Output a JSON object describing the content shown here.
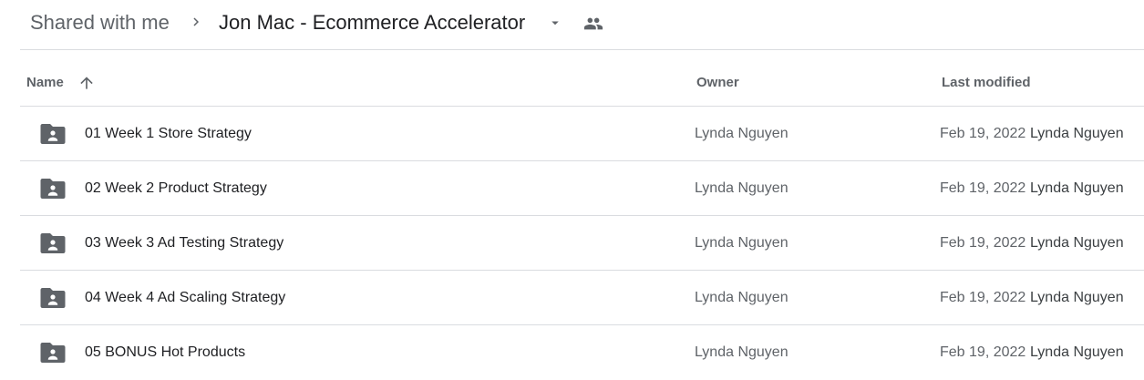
{
  "breadcrumb": {
    "root_label": "Shared with me",
    "separator_icon": "chevron-right-icon",
    "current_folder": "Jon Mac - Ecommerce Accelerator",
    "dropdown_icon": "caret-down-icon",
    "shared_icon": "people-icon"
  },
  "table": {
    "columns": {
      "name": "Name",
      "owner": "Owner",
      "last_modified": "Last modified"
    },
    "sort": {
      "column": "Name",
      "direction": "ascending",
      "icon": "arrow-up-icon"
    },
    "rows": [
      {
        "icon": "shared-folder-icon",
        "name": "01 Week 1 Store Strategy",
        "owner": "Lynda Nguyen",
        "modified_date": "Feb 19, 2022",
        "modified_by": "Lynda Nguyen"
      },
      {
        "icon": "shared-folder-icon",
        "name": "02 Week 2 Product Strategy",
        "owner": "Lynda Nguyen",
        "modified_date": "Feb 19, 2022",
        "modified_by": "Lynda Nguyen"
      },
      {
        "icon": "shared-folder-icon",
        "name": "03 Week 3 Ad Testing Strategy",
        "owner": "Lynda Nguyen",
        "modified_date": "Feb 19, 2022",
        "modified_by": "Lynda Nguyen"
      },
      {
        "icon": "shared-folder-icon",
        "name": "04 Week 4 Ad Scaling Strategy",
        "owner": "Lynda Nguyen",
        "modified_date": "Feb 19, 2022",
        "modified_by": "Lynda Nguyen"
      },
      {
        "icon": "shared-folder-icon",
        "name": "05 BONUS Hot Products",
        "owner": "Lynda Nguyen",
        "modified_date": "Feb 19, 2022",
        "modified_by": "Lynda Nguyen"
      }
    ]
  },
  "colors": {
    "icon_gray": "#5f6368",
    "text_primary": "#202124",
    "divider": "#dadce0"
  }
}
